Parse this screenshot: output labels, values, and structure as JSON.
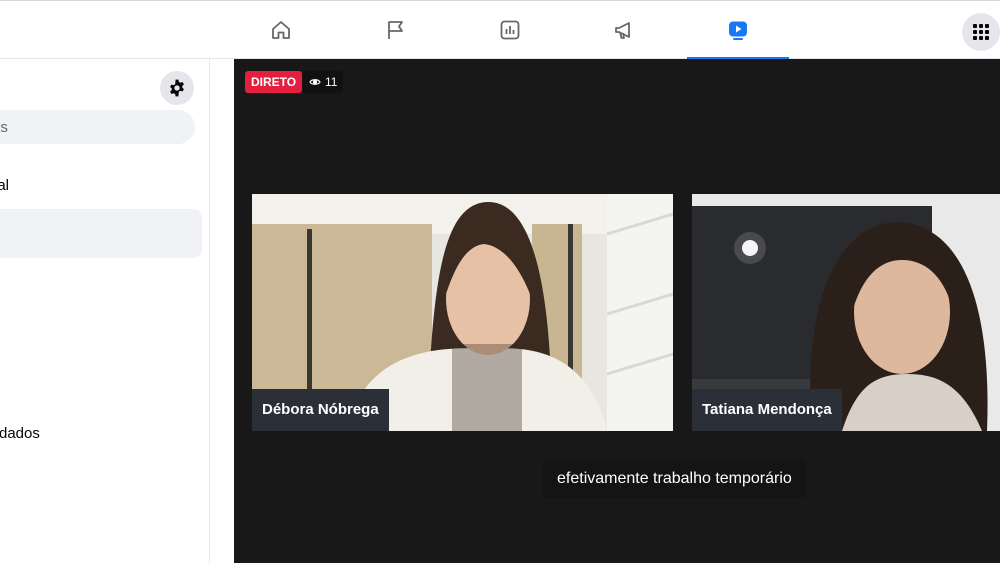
{
  "sidebar": {
    "search_placeholder": "os",
    "items": [
      {
        "label": "ial"
      },
      {
        "label": ""
      },
      {
        "label": "rdados"
      }
    ]
  },
  "nav": {
    "tabs": [
      {
        "icon": "home-icon",
        "active": false
      },
      {
        "icon": "flag-icon",
        "active": false
      },
      {
        "icon": "chart-icon",
        "active": false
      },
      {
        "icon": "megaphone-icon",
        "active": false
      },
      {
        "icon": "video-icon",
        "active": true
      }
    ],
    "accent": "#1877f2"
  },
  "video": {
    "live_label": "DIRETO",
    "viewer_count": "11",
    "participants": [
      {
        "name": "Débora Nóbrega"
      },
      {
        "name": "Tatiana Mendonça"
      }
    ],
    "caption": "efetivamente trabalho temporário",
    "live_color": "#e41e3f"
  }
}
